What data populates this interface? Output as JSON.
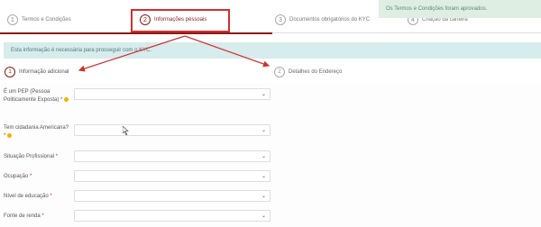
{
  "toast": {
    "text": "Os Termos e Condições foram aprovados."
  },
  "steps": [
    {
      "num": "1",
      "label": "Termos e Condições"
    },
    {
      "num": "2",
      "label": "Informações pessoais"
    },
    {
      "num": "3",
      "label": "Documentos obrigatórios do KYC"
    },
    {
      "num": "4",
      "label": "Criação da carteira"
    }
  ],
  "info_bar": {
    "text": "Esta informação é necessária para prosseguir com o KYC."
  },
  "sub_steps": [
    {
      "num": "1",
      "label": "Informação adicional"
    },
    {
      "num": "2",
      "label": "Detalhes do Endereço"
    }
  ],
  "form": {
    "fields": [
      {
        "label": "É um PEP (Pessoa Politicamente Exposta)",
        "required_mark": "*",
        "has_info_icon": true,
        "value": ""
      },
      {
        "label": "Tem cidadania Americana?",
        "required_mark": "*",
        "has_info_icon": true,
        "value": ""
      },
      {
        "label": "Situação Profissional",
        "required_mark": "*",
        "has_info_icon": false,
        "value": ""
      },
      {
        "label": "Ocupação",
        "required_mark": "*",
        "has_info_icon": false,
        "value": ""
      },
      {
        "label": "Nível de educação",
        "required_mark": "*",
        "has_info_icon": false,
        "value": ""
      },
      {
        "label": "Fonte de renda",
        "required_mark": "*",
        "has_info_icon": false,
        "value": ""
      }
    ]
  },
  "colors": {
    "accent": "#8b1a1a",
    "annotation": "#d32f2f",
    "toast_bg": "#dfeee3",
    "info_bg": "#d7ecec"
  },
  "icons": {
    "select_caret": "chevron-down-icon",
    "info": "info-icon"
  }
}
